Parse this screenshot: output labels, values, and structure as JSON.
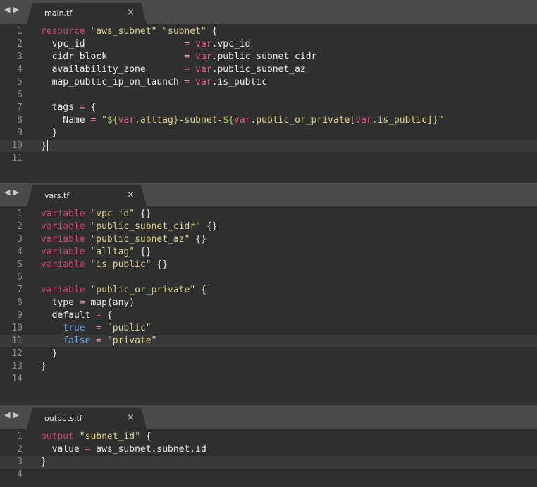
{
  "nav": {
    "back": "◀",
    "forward": "▶"
  },
  "tabs": [
    {
      "title": "main.tf",
      "close": "×"
    },
    {
      "title": "vars.tf",
      "close": "×"
    },
    {
      "title": "outputs.tf",
      "close": "×"
    }
  ],
  "files": {
    "main": {
      "active_line": 10,
      "lines": [
        [
          [
            "k",
            "resource"
          ],
          [
            "p",
            " "
          ],
          [
            "s",
            "\"aws_subnet\""
          ],
          [
            "p",
            " "
          ],
          [
            "s",
            "\"subnet\""
          ],
          [
            "p",
            " {"
          ]
        ],
        [
          [
            "p",
            "  vpc_id                  "
          ],
          [
            "o",
            "="
          ],
          [
            "p",
            " "
          ],
          [
            "v",
            "var"
          ],
          [
            "p",
            ".vpc_id"
          ]
        ],
        [
          [
            "p",
            "  cidr_block              "
          ],
          [
            "o",
            "="
          ],
          [
            "p",
            " "
          ],
          [
            "v",
            "var"
          ],
          [
            "p",
            ".public_subnet_cidr"
          ]
        ],
        [
          [
            "p",
            "  availability_zone       "
          ],
          [
            "o",
            "="
          ],
          [
            "p",
            " "
          ],
          [
            "v",
            "var"
          ],
          [
            "p",
            ".public_subnet_az"
          ]
        ],
        [
          [
            "p",
            "  map_public_ip_on_launch "
          ],
          [
            "o",
            "="
          ],
          [
            "p",
            " "
          ],
          [
            "v",
            "var"
          ],
          [
            "p",
            ".is_public"
          ]
        ],
        [],
        [
          [
            "p",
            "  tags "
          ],
          [
            "o",
            "="
          ],
          [
            "p",
            " {"
          ]
        ],
        [
          [
            "p",
            "    Name "
          ],
          [
            "o",
            "="
          ],
          [
            "p",
            " "
          ],
          [
            "s",
            "\""
          ],
          [
            "i",
            "${"
          ],
          [
            "v",
            "var"
          ],
          [
            "s",
            ".alltag"
          ],
          [
            "i",
            "}"
          ],
          [
            "s",
            "-subnet-"
          ],
          [
            "i",
            "${"
          ],
          [
            "v",
            "var"
          ],
          [
            "s",
            ".public_or_private["
          ],
          [
            "v",
            "var"
          ],
          [
            "s",
            ".is_public]"
          ],
          [
            "i",
            "}"
          ],
          [
            "s",
            "\""
          ]
        ],
        [
          [
            "p",
            "  }"
          ]
        ],
        [
          [
            "p",
            "}"
          ]
        ],
        []
      ]
    },
    "vars": {
      "active_line": 11,
      "lines": [
        [
          [
            "k",
            "variable"
          ],
          [
            "p",
            " "
          ],
          [
            "s",
            "\"vpc_id\""
          ],
          [
            "p",
            " {}"
          ]
        ],
        [
          [
            "k",
            "variable"
          ],
          [
            "p",
            " "
          ],
          [
            "s",
            "\"public_subnet_cidr\""
          ],
          [
            "p",
            " {}"
          ]
        ],
        [
          [
            "k",
            "variable"
          ],
          [
            "p",
            " "
          ],
          [
            "s",
            "\"public_subnet_az\""
          ],
          [
            "p",
            " {}"
          ]
        ],
        [
          [
            "k",
            "variable"
          ],
          [
            "p",
            " "
          ],
          [
            "s",
            "\"alltag\""
          ],
          [
            "p",
            " {}"
          ]
        ],
        [
          [
            "k",
            "variable"
          ],
          [
            "p",
            " "
          ],
          [
            "s",
            "\"is_public\""
          ],
          [
            "p",
            " {}"
          ]
        ],
        [],
        [
          [
            "k",
            "variable"
          ],
          [
            "p",
            " "
          ],
          [
            "s",
            "\"public_or_private\""
          ],
          [
            "p",
            " {"
          ]
        ],
        [
          [
            "p",
            "  type "
          ],
          [
            "o",
            "="
          ],
          [
            "p",
            " map(any)"
          ]
        ],
        [
          [
            "p",
            "  default "
          ],
          [
            "o",
            "="
          ],
          [
            "p",
            " {"
          ]
        ],
        [
          [
            "p",
            "    "
          ],
          [
            "b",
            "true"
          ],
          [
            "p",
            "  "
          ],
          [
            "o",
            "="
          ],
          [
            "p",
            " "
          ],
          [
            "s",
            "\"public\""
          ]
        ],
        [
          [
            "p",
            "    "
          ],
          [
            "b",
            "false"
          ],
          [
            "p",
            " "
          ],
          [
            "o",
            "="
          ],
          [
            "p",
            " "
          ],
          [
            "s",
            "\"private\""
          ]
        ],
        [
          [
            "p",
            "  }"
          ]
        ],
        [
          [
            "p",
            "}"
          ]
        ],
        []
      ]
    },
    "outputs": {
      "active_line": 3,
      "lines": [
        [
          [
            "k",
            "output"
          ],
          [
            "p",
            " "
          ],
          [
            "s",
            "\"subnet_id\""
          ],
          [
            "p",
            " {"
          ]
        ],
        [
          [
            "p",
            "  value "
          ],
          [
            "o",
            "="
          ],
          [
            "p",
            " aws_subnet.subnet.id"
          ]
        ],
        [
          [
            "p",
            "}"
          ]
        ],
        []
      ]
    }
  }
}
